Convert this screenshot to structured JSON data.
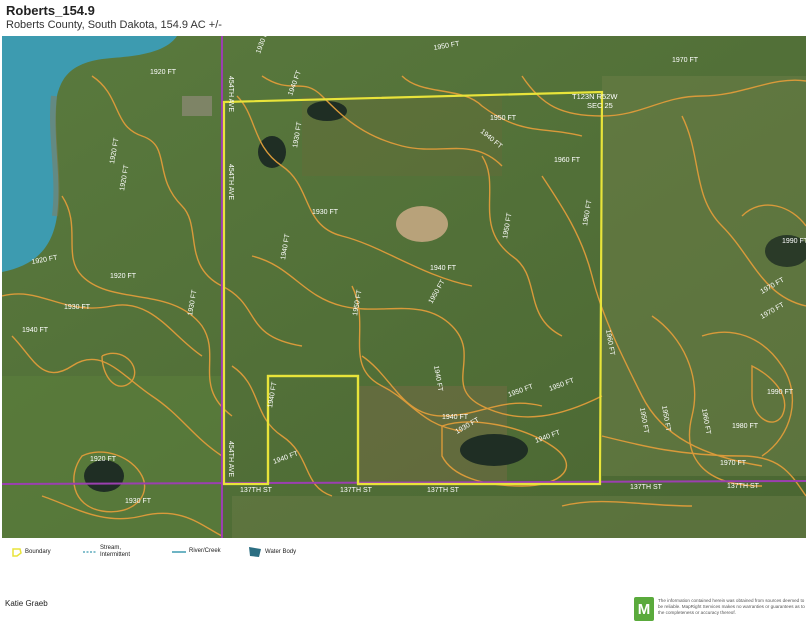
{
  "header": {
    "title": "Roberts_154.9",
    "subtitle": "Roberts County, South Dakota, 154.9 AC +/-"
  },
  "map": {
    "plss_label_1": "T123N R52W",
    "plss_label_2": "SEC 25",
    "roads": {
      "vertical": [
        "454TH AVE",
        "454TH AVE",
        "454TH AVE"
      ],
      "horizontal": [
        "137TH ST",
        "137TH ST",
        "137TH ST",
        "137TH ST",
        "137TH ST"
      ]
    },
    "contours": [
      "1930 FT",
      "1950 FT",
      "1970 FT",
      "1920 FT",
      "1940 FT",
      "1930 FT",
      "1950 FT",
      "1960 FT",
      "1920 FT",
      "1940 FT",
      "1930 FT",
      "1950 FT",
      "1960 FT",
      "1920 FT",
      "1920 FT",
      "1920 FT",
      "1940 FT",
      "1930 FT",
      "1940 FT",
      "1930 FT",
      "1940 FT",
      "1950 FT",
      "1950 FT",
      "1970 FT",
      "1990 FT",
      "1940 FT",
      "1950 FT",
      "1960 FT",
      "1950 FT",
      "1970 FT",
      "1990 FT",
      "1940 FT",
      "1940 FT",
      "1950 FT",
      "1980 FT",
      "1940 FT",
      "1930 FT",
      "1940 FT",
      "1970 FT",
      "1920 FT",
      "1930 FT",
      "1960 FT",
      "1950 FT"
    ],
    "colors": {
      "boundary": "#e8e43a",
      "contour": "#d99a3a",
      "road": "#9b3fb0",
      "water": "#3d9bb0"
    },
    "scale": {
      "ticks": [
        "0",
        "500",
        "1000",
        "1500",
        "2000ft"
      ]
    }
  },
  "legend": {
    "boundary": "Boundary",
    "stream": "Stream, Intermittent",
    "river": "River/Creek",
    "water": "Water Body"
  },
  "footer": {
    "owner": "Katie Graeb",
    "logo_letter": "M",
    "disclaimer": "The information contained herein was obtained from sources deemed to be reliable. MapRight Services makes no warranties or guarantees as to the completeness or accuracy thereof."
  }
}
